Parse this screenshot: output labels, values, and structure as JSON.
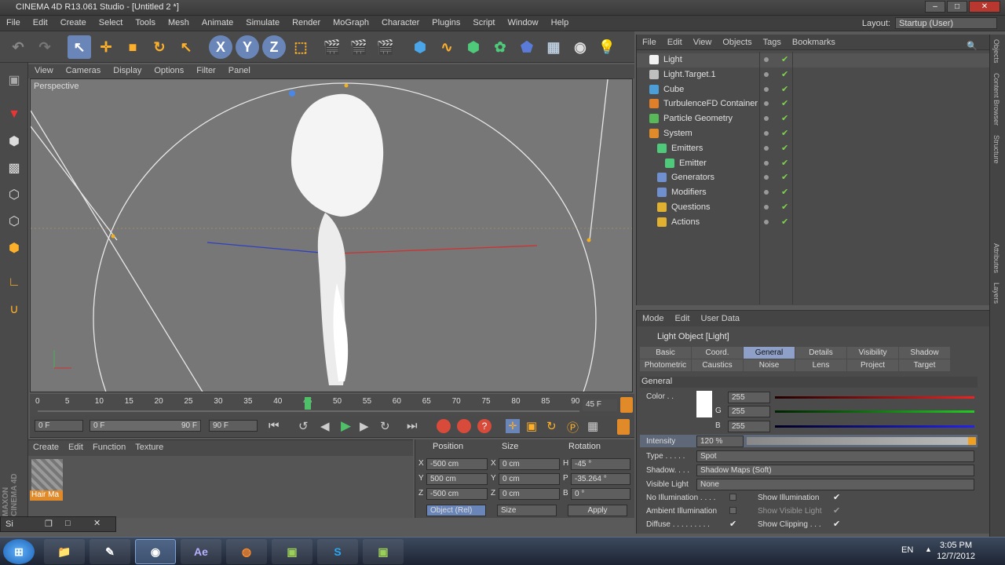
{
  "window": {
    "title": "CINEMA 4D R13.061 Studio - [Untitled 2 *]"
  },
  "menu": [
    "File",
    "Edit",
    "Create",
    "Select",
    "Tools",
    "Mesh",
    "Animate",
    "Simulate",
    "Render",
    "MoGraph",
    "Character",
    "Plugins",
    "Script",
    "Window",
    "Help"
  ],
  "layout": {
    "label": "Layout:",
    "value": "Startup (User)"
  },
  "viewport_menu": [
    "View",
    "Cameras",
    "Display",
    "Options",
    "Filter",
    "Panel"
  ],
  "viewport": {
    "label": "Perspective"
  },
  "timeline": {
    "ticks": [
      "0",
      "5",
      "10",
      "15",
      "20",
      "25",
      "30",
      "35",
      "40",
      "45",
      "50",
      "55",
      "60",
      "65",
      "70",
      "75",
      "80",
      "85",
      "90"
    ],
    "current_frame": "45",
    "end_label": "45 F"
  },
  "transport": {
    "start": "0 F",
    "slider_start": "0 F",
    "slider_end": "90 F",
    "end": "90 F"
  },
  "material_menu": [
    "Create",
    "Edit",
    "Function",
    "Texture"
  ],
  "material": {
    "name": "Hair Ma"
  },
  "coords": {
    "headers": [
      "Position",
      "Size",
      "Rotation"
    ],
    "rows": [
      {
        "axis": "X",
        "pos": "-500 cm",
        "saxis": "X",
        "size": "0 cm",
        "raxis": "H",
        "rot": "-45 °"
      },
      {
        "axis": "Y",
        "pos": "500 cm",
        "saxis": "Y",
        "size": "0 cm",
        "raxis": "P",
        "rot": "-35.264 °"
      },
      {
        "axis": "Z",
        "pos": "-500 cm",
        "saxis": "Z",
        "size": "0 cm",
        "raxis": "B",
        "rot": "0 °"
      }
    ],
    "mode": "Object (Rel)",
    "size_mode": "Size",
    "apply": "Apply"
  },
  "objects_menu": [
    "File",
    "Edit",
    "View",
    "Objects",
    "Tags",
    "Bookmarks"
  ],
  "objects": [
    {
      "name": "Light",
      "indent": 0,
      "color": "#f2f2f2"
    },
    {
      "name": "Light.Target.1",
      "indent": 0,
      "color": "#bfbfbf"
    },
    {
      "name": "Cube",
      "indent": 0,
      "color": "#4b9fd6"
    },
    {
      "name": "TurbulenceFD Container",
      "indent": 0,
      "color": "#e07f2a"
    },
    {
      "name": "Particle Geometry",
      "indent": 0,
      "color": "#57b957"
    },
    {
      "name": "System",
      "indent": 0,
      "color": "#e08a2a"
    },
    {
      "name": "Emitters",
      "indent": 1,
      "color": "#4fc97a"
    },
    {
      "name": "Emitter",
      "indent": 2,
      "color": "#4fc97a"
    },
    {
      "name": "Generators",
      "indent": 1,
      "color": "#6f8fcf"
    },
    {
      "name": "Modifiers",
      "indent": 1,
      "color": "#6f8fcf"
    },
    {
      "name": "Questions",
      "indent": 1,
      "color": "#e0b030"
    },
    {
      "name": "Actions",
      "indent": 1,
      "color": "#e0b030"
    }
  ],
  "attributes_menu": [
    "Mode",
    "Edit",
    "User Data"
  ],
  "attributes": {
    "title": "Light Object [Light]",
    "tabs": [
      "Basic",
      "Coord.",
      "General",
      "Details",
      "Visibility",
      "Shadow",
      "Photometric",
      "Caustics",
      "Noise",
      "Lens",
      "Project",
      "Target"
    ],
    "active_tab": "General",
    "section": "General",
    "color_label": "Color . .",
    "r": "255",
    "g_label": "G",
    "g": "255",
    "b_label": "B",
    "b": "255",
    "intensity_label": "Intensity",
    "intensity": "120 %",
    "type_label": "Type . . . . .",
    "type": "Spot",
    "shadow_label": "Shadow. . . .",
    "shadow": "Shadow Maps (Soft)",
    "visible_light_label": "Visible Light",
    "visible_light": "None",
    "no_illum": "No Illumination . . . .",
    "show_illum": "Show Illumination",
    "ambient": "Ambient Illumination",
    "show_visible": "Show Visible Light",
    "diffuse": "Diffuse . . . . . . . . .",
    "show_clipping": "Show Clipping . . ."
  },
  "side_tabs": [
    "Objects",
    "Content Browser",
    "Structure",
    "Attributes",
    "Layers"
  ],
  "taskbar": {
    "lang": "EN",
    "time": "3:05 PM",
    "date": "12/7/2012"
  },
  "mini": {
    "label": "Si"
  }
}
